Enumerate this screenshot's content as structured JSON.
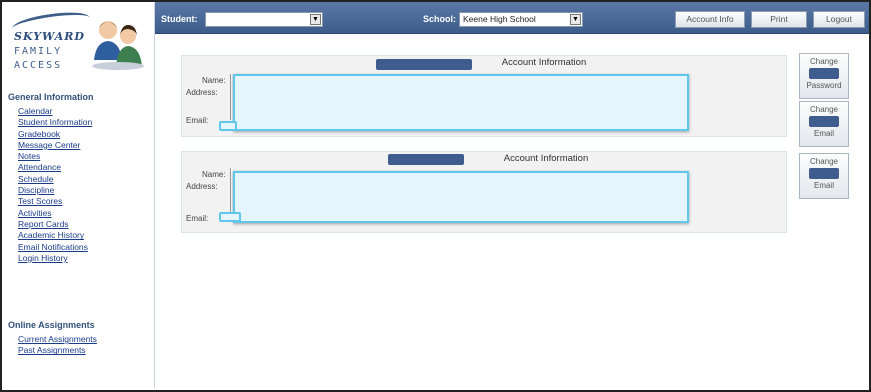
{
  "topbar": {
    "student_label": "Student:",
    "student_value": "",
    "school_label": "School:",
    "school_value": "Keene High School",
    "buttons": [
      "Account Info",
      "Print",
      "Logout"
    ]
  },
  "sidebar": {
    "logo_brand": "SKYWARD",
    "logo_line1": "FAMILY",
    "logo_line2": "ACCESS",
    "general_title": "General Information",
    "general_items": [
      "Calendar",
      "Student Information",
      "Gradebook",
      "Message Center",
      "Notes",
      "Attendance",
      "Schedule",
      "Discipline",
      "Test Scores",
      "Activities",
      "Report Cards",
      "Academic History",
      "Email Notifications",
      "Login History"
    ],
    "online_title": "Online Assignments",
    "online_items": [
      "Current Assignments",
      "Past Assignments"
    ]
  },
  "panels": [
    {
      "title": "Account Information",
      "name_label": "Name:",
      "address_label": "Address:",
      "email_label": "Email:"
    },
    {
      "title": "Account Information",
      "name_label": "Name:",
      "address_label": "Address:",
      "email_label": "Email:"
    }
  ],
  "side_buttons": [
    {
      "top": "Change",
      "bottom": "Password"
    },
    {
      "top": "Change",
      "bottom": "Email"
    },
    {
      "top": "Change",
      "bottom": "Email"
    }
  ],
  "colors": {
    "topbar": "#4a6a97",
    "redaction": "#3e5c8e",
    "highlight_border": "#5fc6ec",
    "highlight_fill": "#e4f5fd",
    "link": "#1a3b8a"
  }
}
